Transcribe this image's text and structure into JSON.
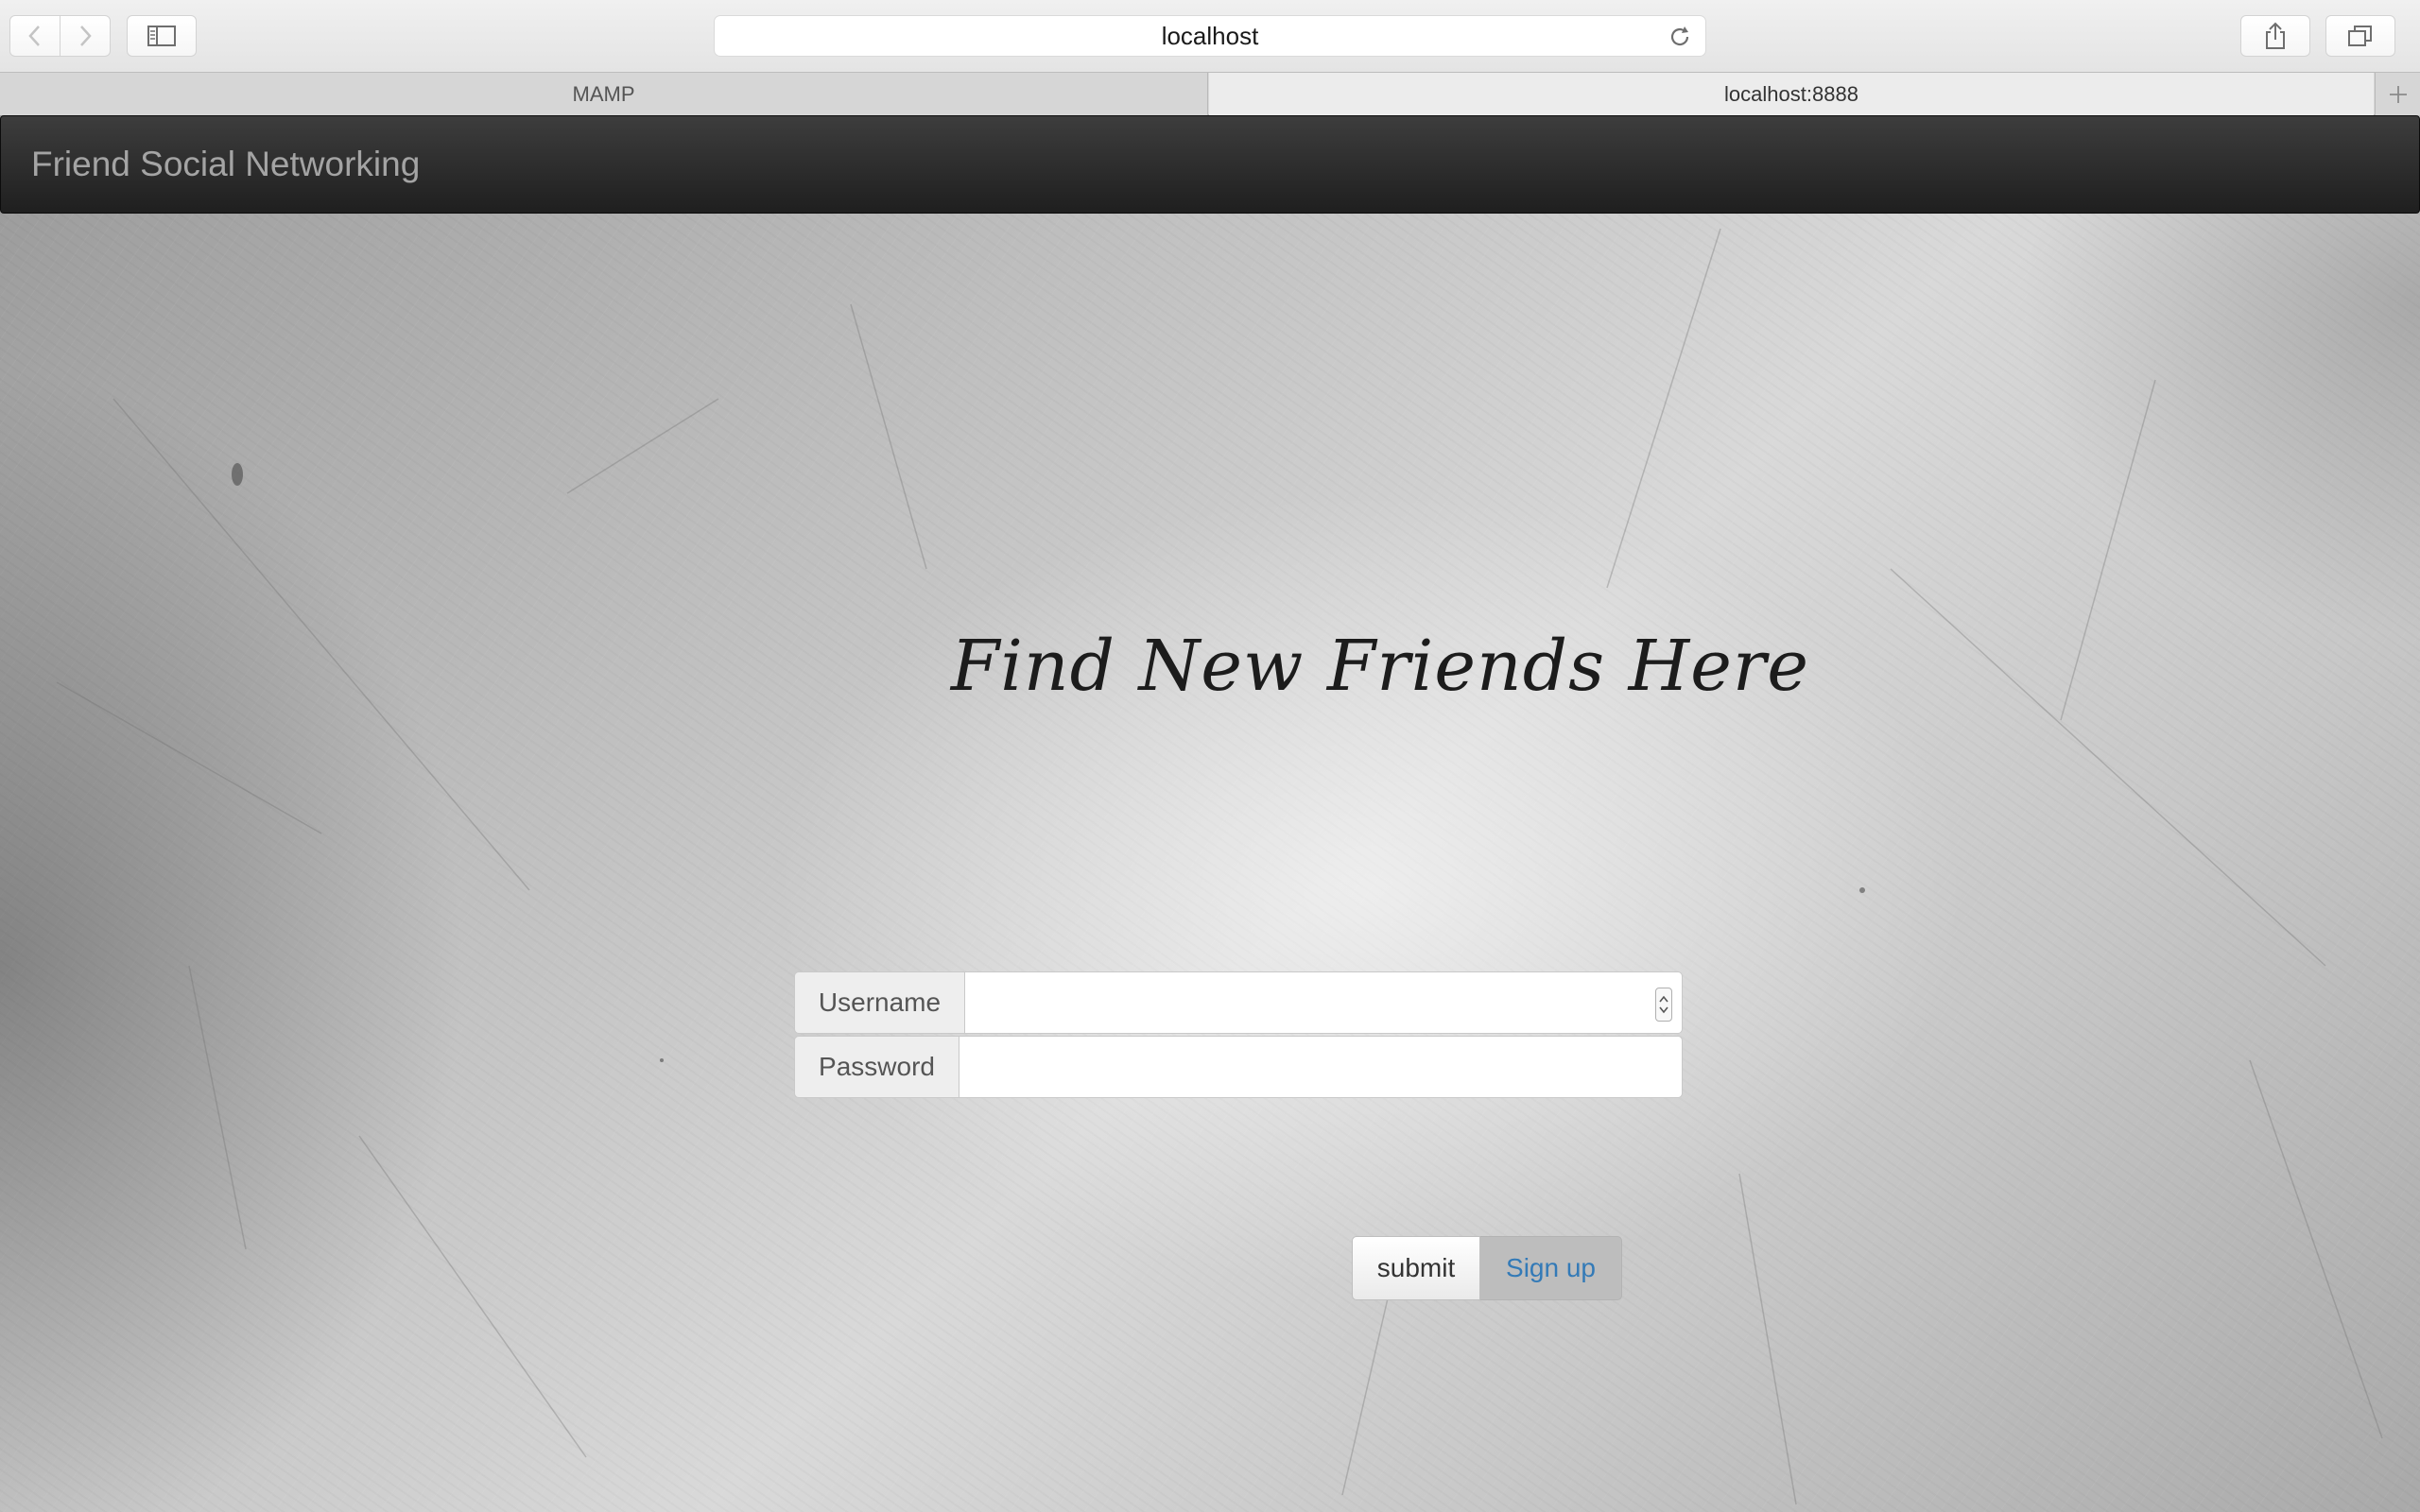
{
  "browser": {
    "address": "localhost",
    "tabs": [
      {
        "label": "MAMP"
      },
      {
        "label": "localhost:8888"
      }
    ],
    "icons": {
      "back": "chevron-left-icon",
      "forward": "chevron-right-icon",
      "sidebar": "sidebar-icon",
      "reload": "reload-icon",
      "share": "share-icon",
      "tabs": "tabs-overview-icon",
      "new_tab": "plus-icon"
    }
  },
  "navbar": {
    "brand": "Friend Social Networking",
    "background": "#2b2b2b",
    "text_color": "#a4a4a4"
  },
  "hero": {
    "headline": "Find New Friends Here"
  },
  "login_form": {
    "username_label": "Username",
    "username_value": "",
    "password_label": "Password",
    "password_value": "",
    "submit_label": "submit",
    "signup_label": "Sign up",
    "signup_color": "#337ab7"
  }
}
